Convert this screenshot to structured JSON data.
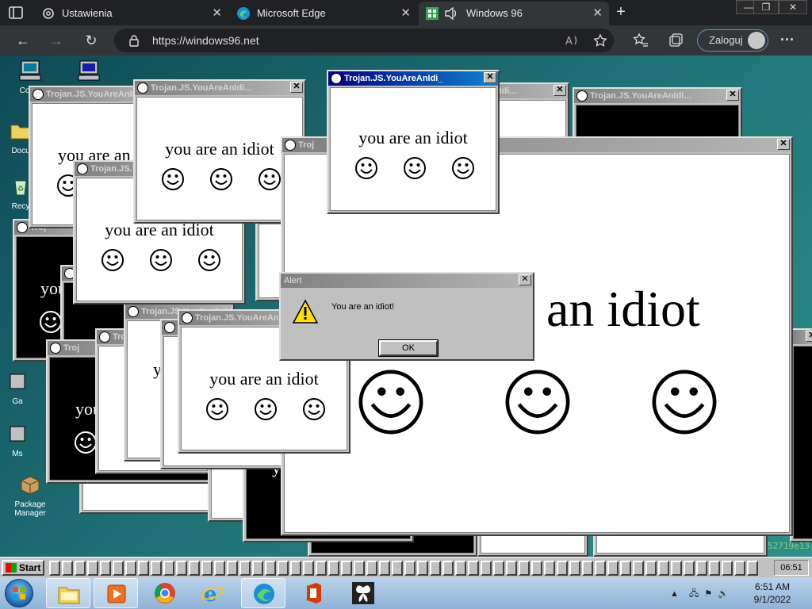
{
  "browser": {
    "tabs": [
      {
        "label": "Ustawienia",
        "close": "✕"
      },
      {
        "label": "Microsoft Edge",
        "close": "✕"
      },
      {
        "label": "Windows 96",
        "close": "✕"
      }
    ],
    "new_tab": "+",
    "url": "https://windows96.net",
    "signin_label": "Zaloguj",
    "more": "···",
    "win_min": "—",
    "win_restore": "❐",
    "win_close": "✕"
  },
  "desktop": {
    "icons": [
      {
        "label": "Comp"
      },
      {
        "label": ""
      },
      {
        "label": "Docu"
      },
      {
        "label": "Recy"
      },
      {
        "label": "Ga"
      },
      {
        "label": "Ms"
      },
      {
        "label": "Package Manager"
      }
    ]
  },
  "windows": {
    "title": "Trojan.JS.YouAreAnIdi...",
    "title_full": "Trojan.JS.YouAreAnIdi_",
    "title_short": "Troj",
    "message": "you are an idiot",
    "message_big": "an idiot",
    "close": "✕"
  },
  "alert": {
    "title": "Alert",
    "message": "You are an idiot!",
    "ok_label": "OK",
    "close": "✕"
  },
  "taskbar95": {
    "start_label": "Start",
    "clock": "06:51"
  },
  "taskbar7": {
    "time": "6:51 AM",
    "date": "9/1/2022"
  },
  "terminal_text": "52719e13",
  "colors": {
    "active_title": "#000080",
    "inactive_title": "#808080",
    "desktop": "#1d6f73"
  }
}
